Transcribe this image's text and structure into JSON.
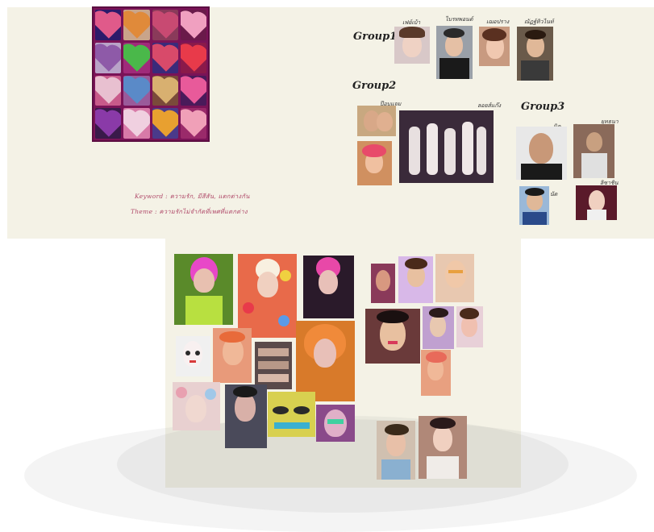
{
  "groups": {
    "group1": {
      "label": "Group1",
      "members": [
        "เฟย์เบ้า",
        "ไบรทพอนด์",
        "เฌอปราง",
        "ณัฏฐ์ทิวไนท์"
      ]
    },
    "group2": {
      "label": "Group2",
      "members": [
        "ป๊อบแจม",
        "ลอยส์แก๊ง"
      ]
    },
    "group3": {
      "label": "Group3",
      "members": [
        "นิค",
        "ยุทธนา",
        "นัด",
        "ลิซาชิน"
      ]
    }
  },
  "notes": {
    "keyword": "Keyword  : ความรัก, มีสีสัน, แตกต่างกัน",
    "theme": "Theme     :  ความรักไม่จำกัดที่เพศที่แตกต่าง"
  },
  "colors": {
    "board": "#f4f2e6",
    "collage_frame": "#7a1357",
    "note_text": "#b04a6a"
  }
}
